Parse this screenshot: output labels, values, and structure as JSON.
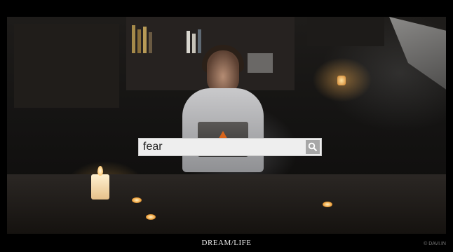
{
  "search": {
    "value": "fear"
  },
  "footer": {
    "title": "DREAM/LIFE",
    "credit": "© DAVI.IN"
  },
  "icons": {
    "search_button": "search-icon"
  },
  "colors": {
    "search_box_bg": "#eeeeee",
    "search_button_bg": "#a7a7a7",
    "footer_text": "#e8e8e8"
  }
}
